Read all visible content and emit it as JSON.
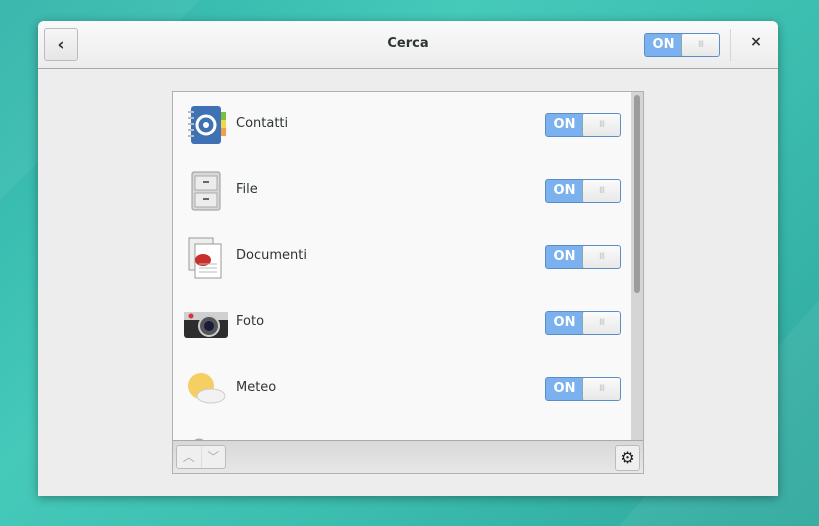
{
  "header": {
    "title": "Cerca",
    "back_label": "‹",
    "master_switch": {
      "label": "ON",
      "state": true
    },
    "close_label": "×"
  },
  "items": [
    {
      "label": "Contatti",
      "icon": "contacts-icon",
      "switch": "ON"
    },
    {
      "label": "File",
      "icon": "file-cabinet-icon",
      "switch": "ON"
    },
    {
      "label": "Documenti",
      "icon": "documents-icon",
      "switch": "ON"
    },
    {
      "label": "Foto",
      "icon": "camera-icon",
      "switch": "ON"
    },
    {
      "label": "Meteo",
      "icon": "weather-icon",
      "switch": "ON"
    }
  ],
  "toolbar": {
    "up": "︿",
    "down": "﹀",
    "settings": "⚙"
  },
  "colors": {
    "accent": "#7ab1ee",
    "background": "#3ec4b4"
  }
}
